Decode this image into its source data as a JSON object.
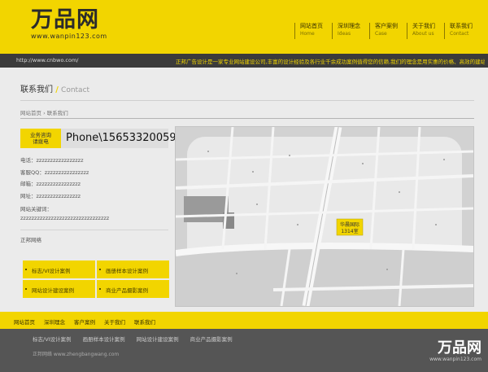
{
  "header": {
    "logo": "万品网",
    "logo_sub": "www.wanpin123.com",
    "nav": [
      {
        "cn": "网站首页",
        "en": "Home"
      },
      {
        "cn": "深圳理念",
        "en": "Ideas"
      },
      {
        "cn": "客户案例",
        "en": "Case"
      },
      {
        "cn": "关于我们",
        "en": "About us"
      },
      {
        "cn": "联系我们",
        "en": "Contact"
      }
    ]
  },
  "strip": {
    "url": "http://www.cnbwo.com/",
    "ticker": "正邦广告设计是一家专业网站建设公司,丰富的设计经验及各行业千余成功案例值得您的信赖,我们的理念是用实惠的价格、高效的建站团"
  },
  "page": {
    "title_cn": "联系我们",
    "title_sep": "/",
    "title_en": "Contact",
    "breadcrumb": "网站首页 › 联系我们"
  },
  "contact": {
    "hotline_label_1": "业务咨询",
    "hotline_label_2": "请拨电",
    "phone": "Phone\\15653320059",
    "rows": [
      "电话：zzzzzzzzzzzzzzzzz",
      "客服QQ：zzzzzzzzzzzzzzzz",
      "邮箱：zzzzzzzzzzzzzzzz",
      "网址：zzzzzzzzzzzzzzzz"
    ],
    "keywords_label": "网站关键词：",
    "keywords": "zzzzzzzzzzzzzzzzzzzzzzzzzzzzzzzz",
    "company": "正邦网络"
  },
  "tiles": [
    "标志/VI设计案例",
    "画册样本设计案例",
    "网站设计建设案例",
    "商业产品摄影案例"
  ],
  "map": {
    "marker_line1": "华晨国际",
    "marker_line2": "1314室"
  },
  "footer": {
    "nav": [
      "网站首页",
      "深圳理念",
      "客户案例",
      "关于我们",
      "联系我们"
    ],
    "links": [
      "标志/VI设计案例",
      "画册样本设计案例",
      "网站设计建设案例",
      "商业产品摄影案例"
    ],
    "copyright": "正邦网络 www.zhengbangwang.com",
    "logo": "万品网",
    "logo_sub": "www.wanpin123.com"
  },
  "colors": {
    "brand_yellow": "#f2d500",
    "dark": "#3b3b3b"
  }
}
